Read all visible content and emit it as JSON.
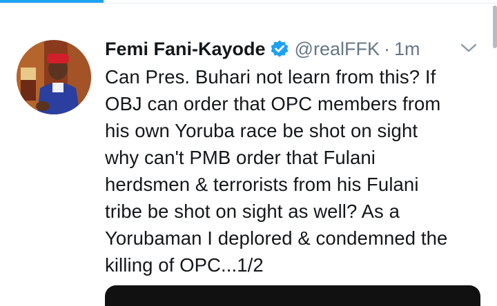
{
  "tweet": {
    "author": {
      "display_name": "Femi Fani-Kayode",
      "handle": "@realFFK",
      "verified": true,
      "avatar_icon": "profile-photo"
    },
    "separator": "·",
    "timestamp": "1m",
    "text": "Can Pres. Buhari not learn from this? If\nOBJ can order that OPC members from\nhis own Yoruba race be shot on sight\nwhy can't PMB order that Fulani\nherdsmen & terrorists from his Fulani\ntribe be shot on sight as well? As a\nYorubaman I deplored & condemned the\nkilling of OPC...1/2",
    "menu_icon": "chevron-down-icon"
  },
  "colors": {
    "accent": "#1da1f2",
    "text": "#14171a",
    "secondary": "#657786"
  }
}
